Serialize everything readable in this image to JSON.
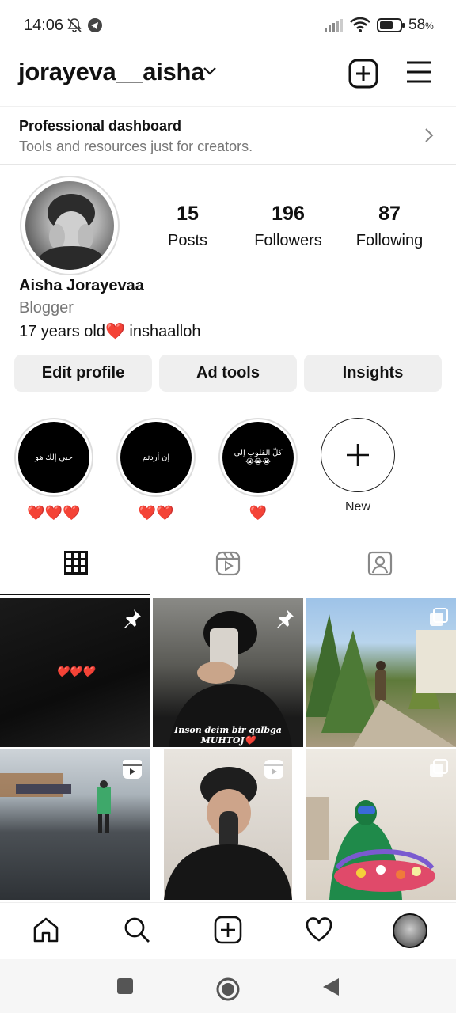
{
  "status_bar": {
    "time": "14:06",
    "battery": "58",
    "battery_unit": "%",
    "icons": [
      "bell-off-icon",
      "telegram-icon",
      "signal-icon",
      "wifi-icon",
      "battery-icon"
    ]
  },
  "header": {
    "username": "jorayeva__aisha",
    "icons": [
      "chevron-down-icon",
      "new-post-icon",
      "menu-icon"
    ]
  },
  "dashboard": {
    "title": "Professional dashboard",
    "subtitle": "Tools and resources just for creators."
  },
  "profile": {
    "stats": [
      {
        "value": "15",
        "label": "Posts"
      },
      {
        "value": "196",
        "label": "Followers"
      },
      {
        "value": "87",
        "label": "Following"
      }
    ],
    "name": "Aisha Jorayevaa",
    "category": "Blogger",
    "bio": "17 years old❤️ inshaalloh"
  },
  "buttons": {
    "edit": "Edit profile",
    "ad_tools": "Ad tools",
    "insights": "Insights"
  },
  "highlights": [
    {
      "cover_text": "حبي إلك هو",
      "label": "❤️❤️❤️"
    },
    {
      "cover_text": "إن أردتم",
      "label": "❤️❤️"
    },
    {
      "cover_text": "كلّ القلوب إلى",
      "cover_emoji": "😭😭😭",
      "label": "❤️"
    },
    {
      "label": "New"
    }
  ],
  "tabs": [
    "grid-icon",
    "reels-icon",
    "tagged-icon"
  ],
  "grid": [
    {
      "type": "pinned",
      "caption": "❤️❤️❤️"
    },
    {
      "type": "pinned",
      "caption_line1": "Inson deim bir qalbga",
      "caption_line2": "MUHTOJ❤️"
    },
    {
      "type": "carousel"
    },
    {
      "type": "reel"
    },
    {
      "type": "reel"
    },
    {
      "type": "carousel"
    }
  ],
  "colors": {
    "accent": "#0095f6",
    "heart": "#e0245e",
    "button_bg": "#efefef"
  }
}
